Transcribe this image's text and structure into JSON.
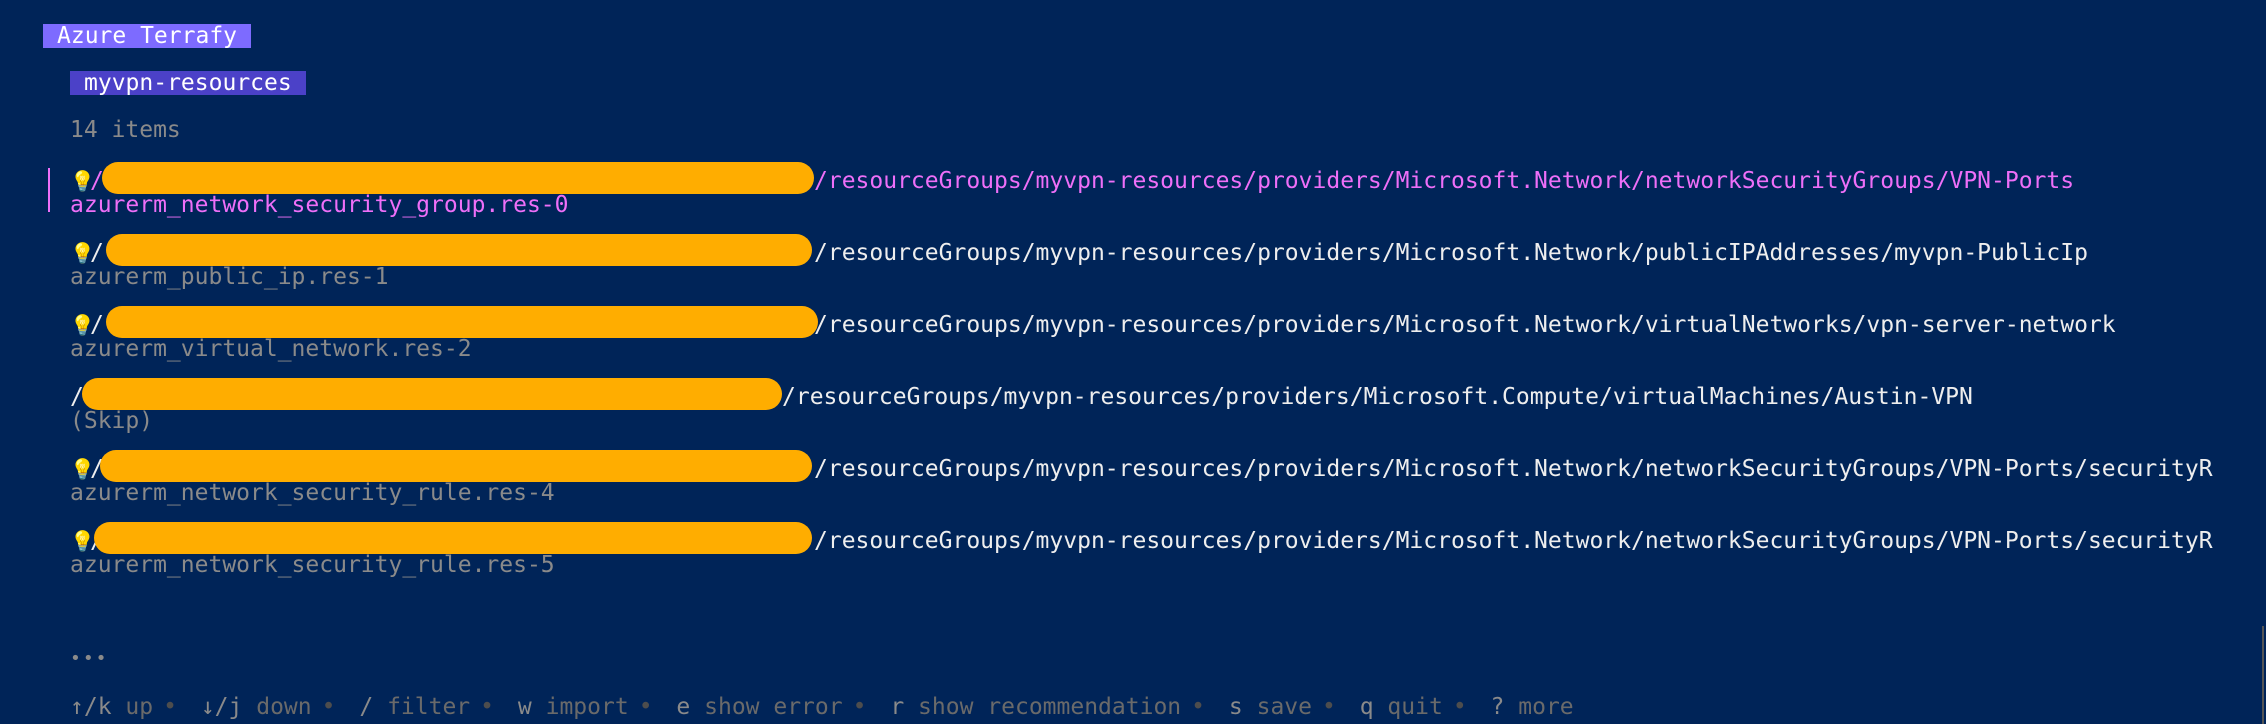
{
  "app": {
    "title": "Azure Terrafy"
  },
  "list": {
    "title": "myvpn-resources",
    "count": "14 items"
  },
  "items": [
    {
      "id_prefix": "/",
      "path": "/resourceGroups/myvpn-resources/providers/Microsoft.Network/networkSecurityGroups/VPN-Ports",
      "mapping": "azurerm_network_security_group.res-0",
      "has_recommendation": true,
      "selected": true
    },
    {
      "id_prefix": "/",
      "path": "/resourceGroups/myvpn-resources/providers/Microsoft.Network/publicIPAddresses/myvpn-PublicIp",
      "mapping": "azurerm_public_ip.res-1",
      "has_recommendation": true,
      "selected": false
    },
    {
      "id_prefix": "/",
      "path": "/resourceGroups/myvpn-resources/providers/Microsoft.Network/virtualNetworks/vpn-server-network",
      "mapping": "azurerm_virtual_network.res-2",
      "has_recommendation": true,
      "selected": false
    },
    {
      "id_prefix": "/",
      "path": "/resourceGroups/myvpn-resources/providers/Microsoft.Compute/virtualMachines/Austin-VPN",
      "mapping": "(Skip)",
      "has_recommendation": false,
      "selected": false
    },
    {
      "id_prefix": "/",
      "path": "/resourceGroups/myvpn-resources/providers/Microsoft.Network/networkSecurityGroups/VPN-Ports/securityR",
      "mapping": "azurerm_network_security_rule.res-4",
      "has_recommendation": true,
      "selected": false
    },
    {
      "id_prefix": "/",
      "path": "/resourceGroups/myvpn-resources/providers/Microsoft.Network/networkSecurityGroups/VPN-Ports/securityR",
      "mapping": "azurerm_network_security_rule.res-5",
      "has_recommendation": true,
      "selected": false
    }
  ],
  "pagination": {
    "dots": "•••"
  },
  "help": [
    {
      "key": "↑/k",
      "label": "up"
    },
    {
      "key": "↓/j",
      "label": "down"
    },
    {
      "key": "/",
      "label": "filter"
    },
    {
      "key": "w",
      "label": "import"
    },
    {
      "key": "e",
      "label": "show error"
    },
    {
      "key": "r",
      "label": "show recommendation"
    },
    {
      "key": "s",
      "label": "save"
    },
    {
      "key": "q",
      "label": "quit"
    },
    {
      "key": "?",
      "label": "more"
    }
  ],
  "colors": {
    "background": "#002458",
    "title_bg": "#7d6bff",
    "list_title_bg": "#4b41c8",
    "selected": "#ee6ff8",
    "redaction": "#ffad00"
  },
  "icons": {
    "recommendation": "lightbulb-icon"
  }
}
